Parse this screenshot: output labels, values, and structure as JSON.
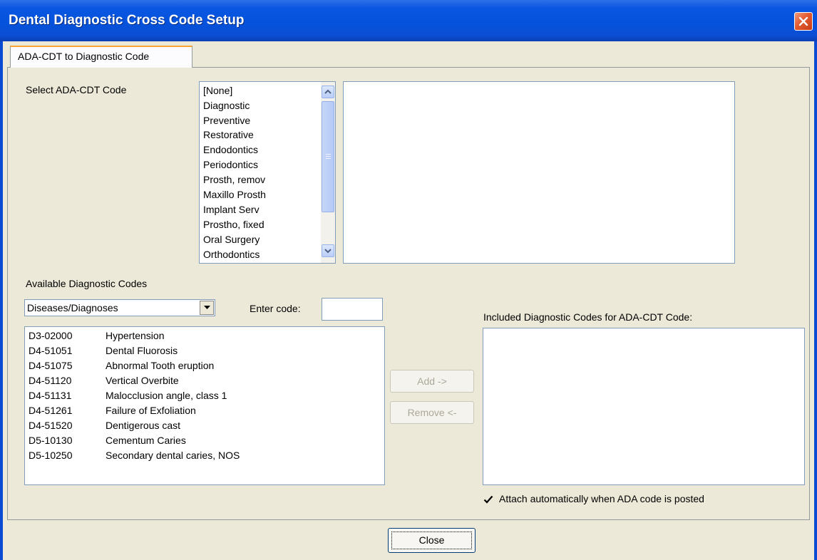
{
  "window": {
    "title": "Dental Diagnostic Cross Code Setup"
  },
  "tabs": [
    {
      "label": "ADA-CDT to Diagnostic Code"
    }
  ],
  "select_code": {
    "label": "Select ADA-CDT Code",
    "categories": [
      "[None]",
      "Diagnostic",
      "Preventive",
      "Restorative",
      "Endodontics",
      "Periodontics",
      "Prosth, remov",
      "Maxillo Prosth",
      "Implant Serv",
      "Prostho, fixed",
      "Oral Surgery",
      "Orthodontics"
    ]
  },
  "available": {
    "label": "Available Diagnostic Codes",
    "dropdown_value": "Diseases/Diagnoses",
    "enter_code_label": "Enter code:",
    "enter_code_value": "",
    "rows": [
      {
        "code": "D3-02000",
        "desc": "Hypertension"
      },
      {
        "code": "D4-51051",
        "desc": "Dental Fluorosis"
      },
      {
        "code": "D4-51075",
        "desc": "Abnormal Tooth eruption"
      },
      {
        "code": "D4-51120",
        "desc": "Vertical Overbite"
      },
      {
        "code": "D4-51131",
        "desc": "Malocclusion angle, class 1"
      },
      {
        "code": "D4-51261",
        "desc": "Failure of Exfoliation"
      },
      {
        "code": "D4-51520",
        "desc": "Dentigerous cast"
      },
      {
        "code": "D5-10130",
        "desc": "Cementum Caries"
      },
      {
        "code": "D5-10250",
        "desc": "Secondary dental caries, NOS"
      }
    ]
  },
  "buttons": {
    "add": "Add ->",
    "remove": "Remove <-",
    "close": "Close"
  },
  "included": {
    "label": "Included Diagnostic Codes for ADA-CDT Code:",
    "attach_label": "Attach automatically when ADA code is posted",
    "attach_checked": true
  }
}
